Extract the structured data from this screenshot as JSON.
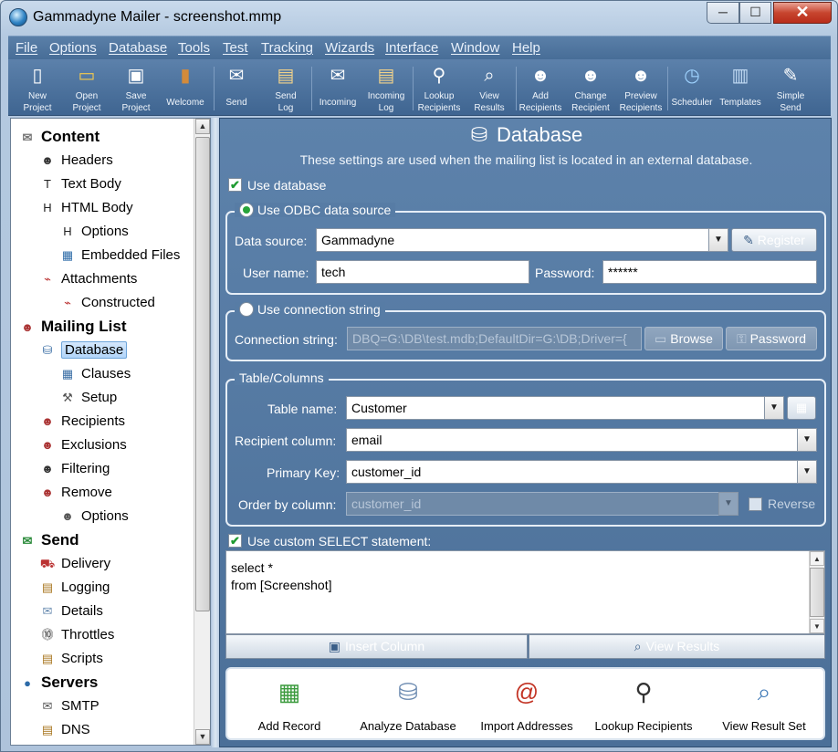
{
  "window": {
    "title": "Gammadyne Mailer - screenshot.mmp",
    "min_glyph": "─",
    "max_glyph": "☐",
    "close_glyph": "✕"
  },
  "menu": [
    "File",
    "Options",
    "Database",
    "Tools",
    "Test",
    "Tracking",
    "Wizards",
    "Interface",
    "Window",
    "Help"
  ],
  "toolbar": [
    {
      "label": "New\nProject",
      "icon": "new-project-icon"
    },
    {
      "label": "Open\nProject",
      "icon": "open-project-icon"
    },
    {
      "label": "Save\nProject",
      "icon": "save-project-icon"
    },
    {
      "label": "Welcome",
      "icon": "welcome-icon"
    },
    {
      "label": "Send",
      "icon": "send-icon"
    },
    {
      "label": "Send\nLog",
      "icon": "send-log-icon"
    },
    {
      "label": "Incoming",
      "icon": "incoming-icon"
    },
    {
      "label": "Incoming\nLog",
      "icon": "incoming-log-icon"
    },
    {
      "label": "Lookup\nRecipients",
      "icon": "lookup-recipients-icon"
    },
    {
      "label": "View\nResults",
      "icon": "view-results-icon"
    },
    {
      "label": "Add\nRecipients",
      "icon": "add-recipients-icon"
    },
    {
      "label": "Change\nRecipient",
      "icon": "change-recipient-icon"
    },
    {
      "label": "Preview\nRecipients",
      "icon": "preview-recipients-icon"
    },
    {
      "label": "Scheduler",
      "icon": "scheduler-icon"
    },
    {
      "label": "Templates",
      "icon": "templates-icon"
    },
    {
      "label": "Simple\nSend",
      "icon": "simple-send-icon"
    }
  ],
  "sidebar": {
    "items": [
      {
        "label": "Content",
        "icon": "content-icon",
        "head": true
      },
      {
        "label": "Headers",
        "icon": "headers-icon"
      },
      {
        "label": "Text Body",
        "icon": "text-body-icon"
      },
      {
        "label": "HTML Body",
        "icon": "html-body-icon"
      },
      {
        "label": "Options",
        "icon": "html-options-icon"
      },
      {
        "label": "Embedded Files",
        "icon": "embedded-files-icon"
      },
      {
        "label": "Attachments",
        "icon": "attachments-icon"
      },
      {
        "label": "Constructed",
        "icon": "constructed-icon"
      },
      {
        "label": "Mailing List",
        "icon": "mailing-list-icon",
        "head": true
      },
      {
        "label": "Database",
        "icon": "database-icon",
        "selected": true
      },
      {
        "label": "Clauses",
        "icon": "clauses-icon"
      },
      {
        "label": "Setup",
        "icon": "setup-icon"
      },
      {
        "label": "Recipients",
        "icon": "recipients-icon"
      },
      {
        "label": "Exclusions",
        "icon": "exclusions-icon"
      },
      {
        "label": "Filtering",
        "icon": "filtering-icon"
      },
      {
        "label": "Remove",
        "icon": "remove-icon"
      },
      {
        "label": "Options",
        "icon": "remove-options-icon"
      },
      {
        "label": "Send",
        "icon": "send-section-icon",
        "head": true
      },
      {
        "label": "Delivery",
        "icon": "delivery-icon"
      },
      {
        "label": "Logging",
        "icon": "logging-icon"
      },
      {
        "label": "Details",
        "icon": "details-icon"
      },
      {
        "label": "Throttles",
        "icon": "throttles-icon"
      },
      {
        "label": "Scripts",
        "icon": "scripts-icon"
      },
      {
        "label": "Servers",
        "icon": "servers-icon",
        "head": true
      },
      {
        "label": "SMTP",
        "icon": "smtp-icon"
      },
      {
        "label": "DNS",
        "icon": "dns-icon"
      }
    ]
  },
  "page": {
    "title": "Database",
    "subtitle": "These settings are used when the mailing list is located in an external database.",
    "use_database": {
      "label": "Use database",
      "checked": true
    },
    "odbc": {
      "label": "Use ODBC data source",
      "selected": true,
      "data_source_label": "Data source:",
      "data_source_value": "Gammadyne",
      "register_label": "Register",
      "user_name_label": "User name:",
      "user_name_value": "tech",
      "password_label": "Password:",
      "password_value": "******"
    },
    "connection": {
      "label": "Use connection string",
      "selected": false,
      "string_label": "Connection string:",
      "string_value": "DBQ=G:\\DB\\test.mdb;DefaultDir=G:\\DB;Driver={",
      "browse_label": "Browse",
      "password_label": "Password"
    },
    "table": {
      "group_label": "Table/Columns",
      "table_name_label": "Table name:",
      "table_name_value": "Customer",
      "recipient_col_label": "Recipient column:",
      "recipient_col_value": "email",
      "primary_key_label": "Primary Key:",
      "primary_key_value": "customer_id",
      "order_by_label": "Order by column:",
      "order_by_value": "customer_id",
      "reverse_label": "Reverse",
      "reverse_checked": false
    },
    "custom_select": {
      "label": "Use custom SELECT statement:",
      "checked": true,
      "lines": [
        "select *",
        "from [Screenshot]"
      ]
    },
    "insert_column_label": "Insert Column",
    "view_results_label": "View Results",
    "actions": [
      {
        "label": "Add Record",
        "icon": "add-record-icon"
      },
      {
        "label": "Analyze Database",
        "icon": "analyze-database-icon"
      },
      {
        "label": "Import Addresses",
        "icon": "import-addresses-icon"
      },
      {
        "label": "Lookup Recipients",
        "icon": "lookup-recipients-icon"
      },
      {
        "label": "View Result Set",
        "icon": "view-result-set-icon"
      }
    ]
  }
}
